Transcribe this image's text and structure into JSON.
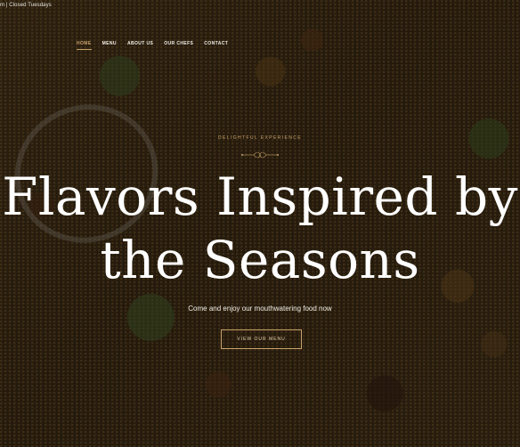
{
  "topbar": {
    "hours_text": "m | Closed Tuesdays"
  },
  "nav": {
    "items": [
      {
        "label": "Home"
      },
      {
        "label": "Menu"
      },
      {
        "label": "About Us"
      },
      {
        "label": "Our Chefs"
      },
      {
        "label": "Contact"
      }
    ],
    "active_index": 0
  },
  "hero": {
    "eyebrow": "Delightful Experience",
    "headline_line1": "Flavors Inspired by",
    "headline_line2": "the Seasons",
    "subtitle": "Come and enjoy our mouthwatering food now",
    "cta_label": "View Our Menu",
    "background_description_icon": "biryani-food-photo"
  },
  "colors": {
    "accent": "#c9a26b",
    "overlay": "#0c0804",
    "text": "#ffffff"
  }
}
